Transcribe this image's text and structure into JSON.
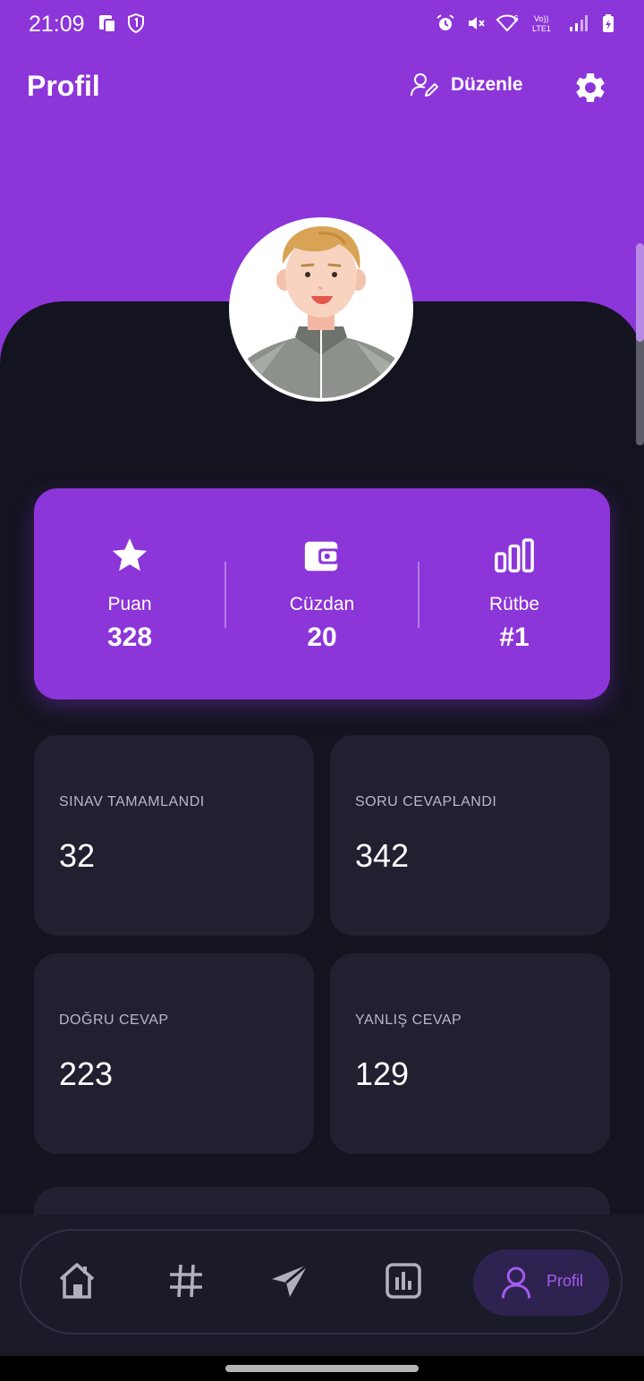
{
  "status_bar": {
    "time": "21:09",
    "icons_left": [
      "screen-mirror-icon",
      "shield-1-icon"
    ],
    "icons_right": [
      "alarm-icon",
      "mute-icon",
      "wifi-6-icon",
      "volte-lte1-icon",
      "signal-icon",
      "battery-charging-icon"
    ],
    "volte_text": "Vo))",
    "lte_text": "LTE1",
    "wifi_badge": "6"
  },
  "header": {
    "title": "Profil",
    "edit_label": "Düzenle"
  },
  "colors": {
    "accent": "#8c35d9",
    "background": "#12121b",
    "card": "#202031",
    "nav_active": "#a45cf0"
  },
  "stats": {
    "points": {
      "label": "Puan",
      "value": "328",
      "icon": "star-icon"
    },
    "wallet": {
      "label": "Cüzdan",
      "value": "20",
      "icon": "wallet-icon"
    },
    "rank": {
      "label": "Rütbe",
      "value": "#1",
      "icon": "rank-bars-icon"
    }
  },
  "tiles": [
    {
      "label": "SINAV TAMAMLANDI",
      "value": "32"
    },
    {
      "label": "SORU CEVAPLANDI",
      "value": "342"
    },
    {
      "label": "DOĞRU CEVAP",
      "value": "223"
    },
    {
      "label": "YANLIŞ CEVAP",
      "value": "129"
    }
  ],
  "nav": {
    "items": [
      "home-icon",
      "hashtag-icon",
      "send-icon",
      "chart-icon"
    ],
    "active_label": "Profil"
  }
}
